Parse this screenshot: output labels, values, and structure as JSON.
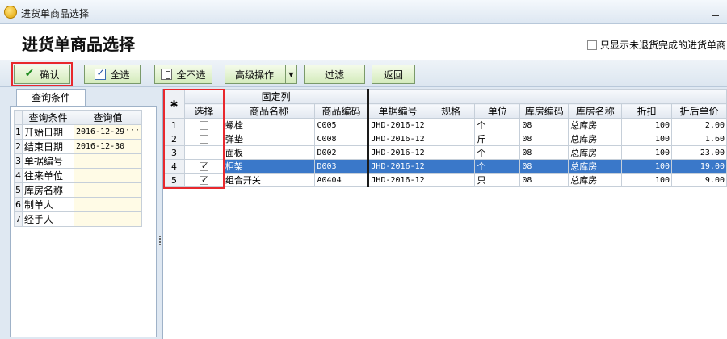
{
  "window": {
    "title": "进货单商品选择"
  },
  "header": {
    "title": "进货单商品选择",
    "filter_label": "只显示未退货完成的进货单商品"
  },
  "toolbar": {
    "confirm": "确认",
    "select_all": "全选",
    "select_none": "全不选",
    "advanced": "高级操作",
    "filter": "过滤",
    "back": "返回"
  },
  "query": {
    "tab": "查询条件",
    "headers": [
      "查询条件",
      "查询值"
    ],
    "rows": [
      {
        "n": "1",
        "name": "开始日期",
        "value": "2016-12-29"
      },
      {
        "n": "2",
        "name": "结束日期",
        "value": "2016-12-30"
      },
      {
        "n": "3",
        "name": "单据编号",
        "value": ""
      },
      {
        "n": "4",
        "name": "往来单位",
        "value": ""
      },
      {
        "n": "5",
        "name": "库房名称",
        "value": ""
      },
      {
        "n": "6",
        "name": "制单人",
        "value": ""
      },
      {
        "n": "7",
        "name": "经手人",
        "value": ""
      }
    ]
  },
  "grid": {
    "corner": "✱",
    "group_header": "固定列",
    "columns": [
      "选择",
      "商品名称",
      "商品编码",
      "单据编号",
      "规格",
      "单位",
      "库房编码",
      "库房名称",
      "折扣",
      "折后单价"
    ],
    "rows": [
      {
        "n": "1",
        "name": "螺栓",
        "code": "C005",
        "doc": "JHD-2016-12",
        "spec": "",
        "unit": "个",
        "wh_code": "08",
        "wh_name": "总库房",
        "discount": "100",
        "price": "2.00"
      },
      {
        "n": "2",
        "name": "弹垫",
        "code": "C008",
        "doc": "JHD-2016-12",
        "spec": "",
        "unit": "斤",
        "wh_code": "08",
        "wh_name": "总库房",
        "discount": "100",
        "price": "1.60"
      },
      {
        "n": "3",
        "name": "面板",
        "code": "D002",
        "doc": "JHD-2016-12",
        "spec": "",
        "unit": "个",
        "wh_code": "08",
        "wh_name": "总库房",
        "discount": "100",
        "price": "23.00"
      },
      {
        "n": "4",
        "name": "柜架",
        "code": "D003",
        "doc": "JHD-2016-12",
        "spec": "",
        "unit": "个",
        "wh_code": "08",
        "wh_name": "总库房",
        "discount": "100",
        "price": "19.00"
      },
      {
        "n": "5",
        "name": "组合开关",
        "code": "A0404",
        "doc": "JHD-2016-12",
        "spec": "",
        "unit": "只",
        "wh_code": "08",
        "wh_name": "总库房",
        "discount": "100",
        "price": "9.00"
      }
    ]
  }
}
